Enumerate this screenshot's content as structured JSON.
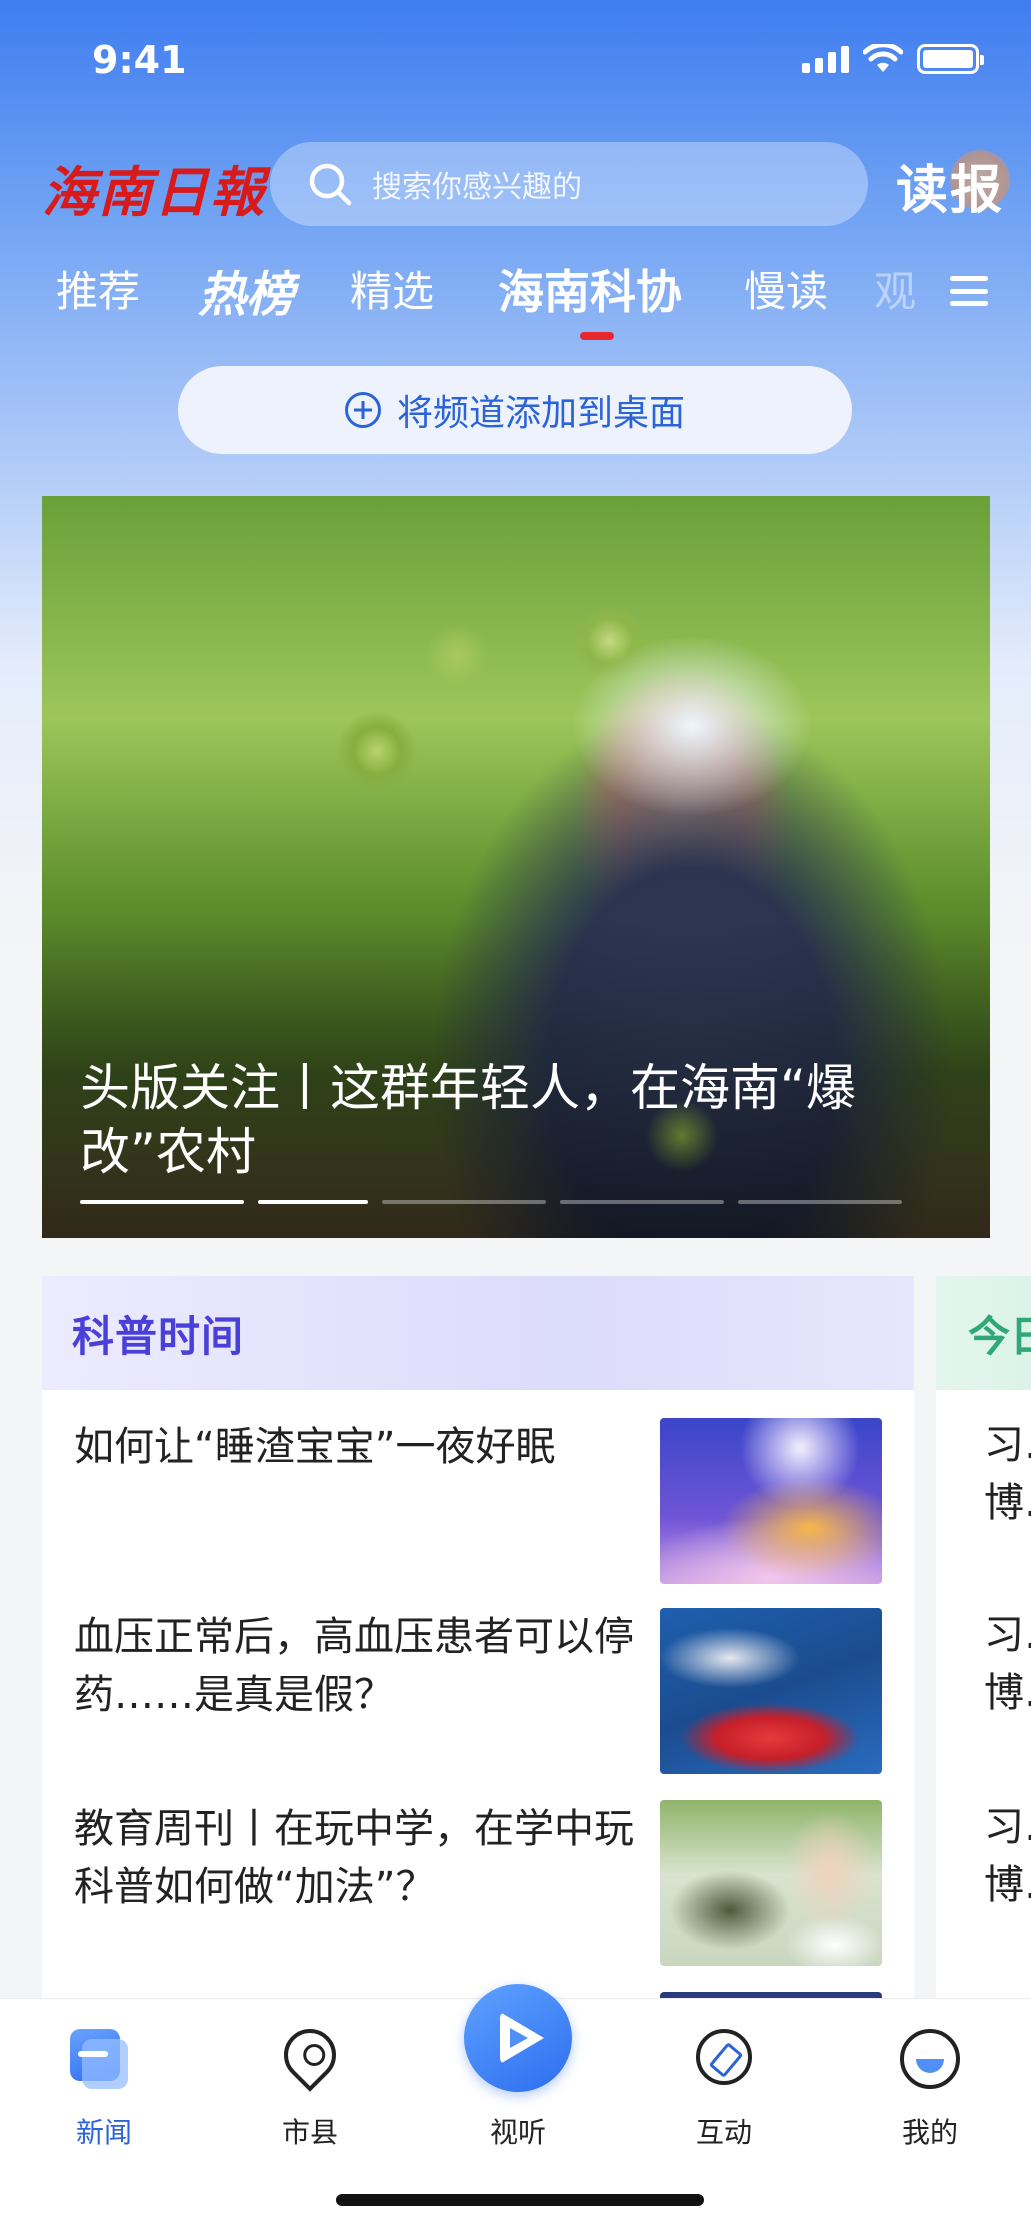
{
  "status_bar": {
    "time": "9:41"
  },
  "header": {
    "logo": "海南日報",
    "search_placeholder": "搜索你感兴趣的",
    "read_paper": "读报"
  },
  "tabs": [
    {
      "label": "推荐",
      "state": "normal"
    },
    {
      "label": "热榜",
      "state": "hot"
    },
    {
      "label": "精选",
      "state": "normal"
    },
    {
      "label": "海南科协",
      "state": "active"
    },
    {
      "label": "慢读",
      "state": "normal"
    },
    {
      "label": "观",
      "state": "faded"
    }
  ],
  "add_channel": {
    "label": "将频道添加到桌面"
  },
  "hero": {
    "title": "头版关注丨这群年轻人，在海南“爆改”农村",
    "slide_index": 2,
    "slide_count": 5
  },
  "card": {
    "title": "科普时间",
    "items": [
      {
        "title": "如何让“睡渣宝宝”一夜好眠",
        "thumb": "sleeping-baby-illustration"
      },
      {
        "title": "血压正常后，高血压患者可以停药……是真是假？",
        "thumb": "red-submersible-at-sea"
      },
      {
        "title": "教育周刊丨在玩中学，在学中玩 科普如何做“加法”？",
        "thumb": "students-with-telescope"
      }
    ]
  },
  "card2": {
    "title": "今日",
    "items": [
      "习…",
      "博…",
      "习…",
      "博…",
      "习…",
      "博…"
    ]
  },
  "bottom_nav": [
    {
      "label": "新闻",
      "icon": "news-icon",
      "active": true
    },
    {
      "label": "市县",
      "icon": "location-pin-icon",
      "active": false
    },
    {
      "label": "视听",
      "icon": "play-icon",
      "active": false
    },
    {
      "label": "互动",
      "icon": "compass-icon",
      "active": false
    },
    {
      "label": "我的",
      "icon": "profile-icon",
      "active": false
    }
  ],
  "colors": {
    "primary": "#2b63d9",
    "brand_red": "#d81a1a",
    "card_accent": "#4a3fd8",
    "card2_accent": "#2ea877"
  }
}
